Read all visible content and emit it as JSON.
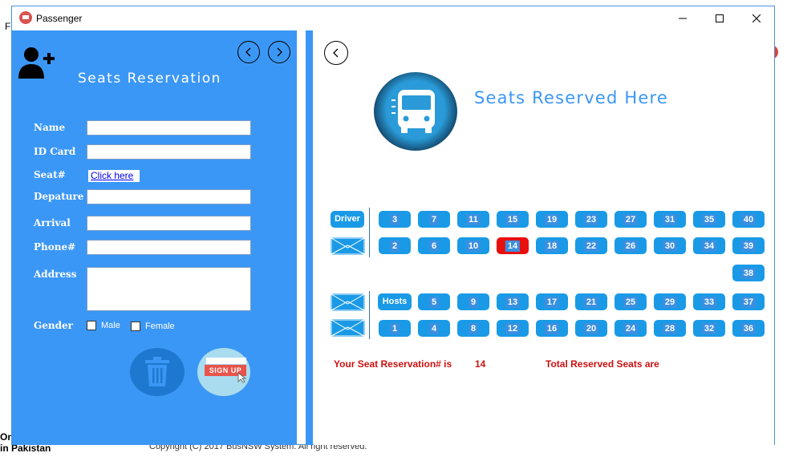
{
  "window": {
    "title": "Passenger"
  },
  "left": {
    "heading": "Seats Reservation",
    "labels": {
      "name": "Name",
      "id": "ID Card",
      "seat": "Seat#",
      "depature": "Depature",
      "arrival": "Arrival",
      "phone": "Phone#",
      "address": "Address",
      "gender": "Gender"
    },
    "click_here": "Click here",
    "gender_options": {
      "male": "Male",
      "female": "Female"
    },
    "signup_label": "SIGN UP"
  },
  "right": {
    "heading": "Seats Reserved Here",
    "driver_label": "Driver",
    "hosts_label": "Hosts",
    "reservation_label": "Your Seat Reservation# is",
    "reservation_value": "14",
    "total_label": "Total Reserved Seats are"
  },
  "seats": {
    "row1": [
      "3",
      "7",
      "11",
      "15",
      "19",
      "23",
      "27",
      "31",
      "35",
      "40"
    ],
    "row2": [
      "2",
      "6",
      "10",
      "14",
      "18",
      "22",
      "26",
      "30",
      "34",
      "39"
    ],
    "row3": [
      "38"
    ],
    "row4": [
      "5",
      "9",
      "13",
      "17",
      "21",
      "25",
      "29",
      "33",
      "37"
    ],
    "row5": [
      "1",
      "4",
      "8",
      "12",
      "16",
      "20",
      "24",
      "28",
      "32",
      "36"
    ],
    "reserved": [
      "14"
    ]
  },
  "background_fragments": {
    "frag_fl": "Fl",
    "frag_on": "On",
    "frag_in_pakistan": "in Pakistan",
    "copyright": "Copyright (C) 2017 BusNSW System. All right reserved."
  },
  "colors": {
    "panel_blue": "#3b97f5",
    "seat_blue": "#1a9ae6",
    "reserved_red": "#e8100f",
    "info_red": "#cc1111"
  }
}
